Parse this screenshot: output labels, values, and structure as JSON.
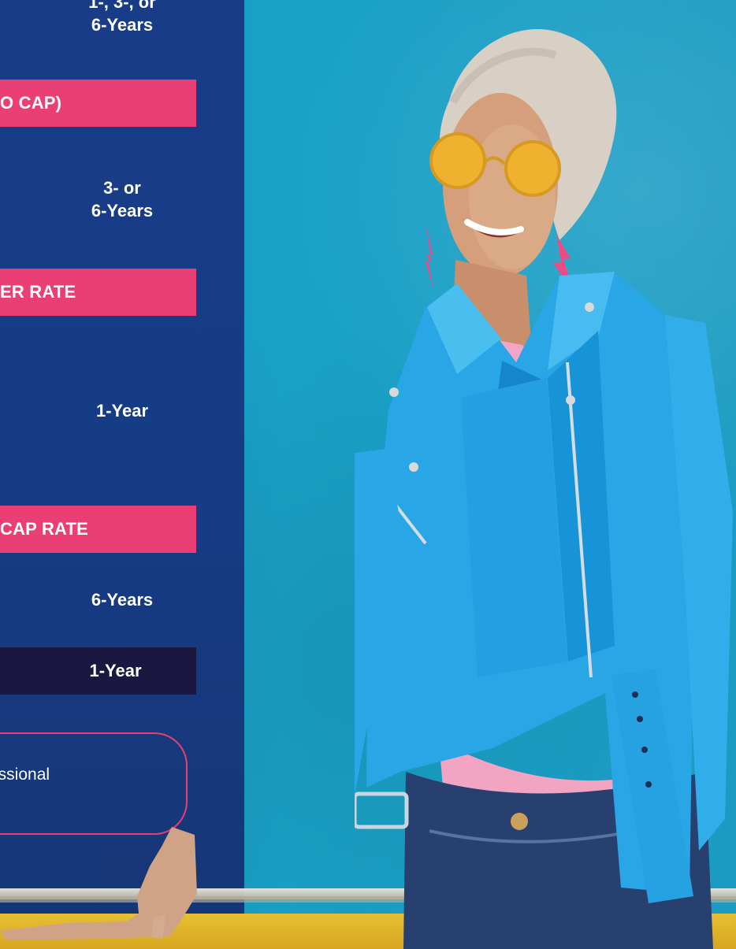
{
  "left_panel": {
    "term1_lines": [
      "1-, 3-, or",
      "6-Years"
    ],
    "pill1": "O CAP)",
    "term2_lines": [
      "3- or",
      "6-Years"
    ],
    "pill2": "ER RATE",
    "term3": "1-Year",
    "pill3": "CAP RATE",
    "term4": "6-Years",
    "dark_pill": "1-Year",
    "bubble_text": "essional"
  },
  "colors": {
    "panel_blue": "#183c87",
    "pink": "#ea3f74",
    "dark_navy": "#1a1840",
    "teal_wall": "#19a2c8",
    "yellow_ledge": "#e6bf33"
  },
  "photo": {
    "subject": "smiling-woman-blue-leather-jacket"
  }
}
